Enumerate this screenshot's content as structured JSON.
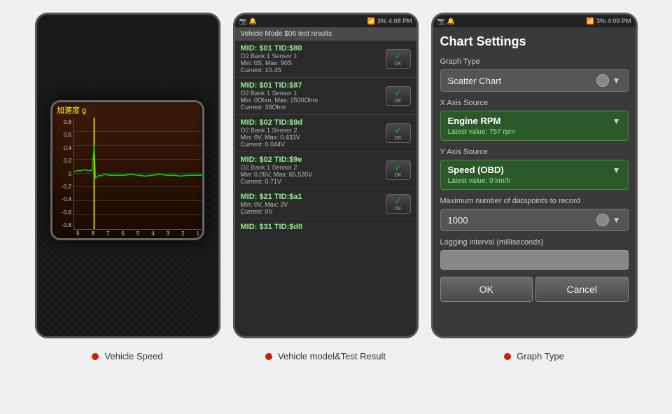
{
  "panel1": {
    "chart_title": "加速度 g",
    "y_labels": [
      "0.8",
      "0.6",
      "0.4",
      "0.2",
      "0",
      "-0.2",
      "-0.4",
      "-0.6",
      "-0.8"
    ],
    "x_labels": [
      "9",
      "8",
      "7",
      "6",
      "5",
      "4",
      "3",
      "2",
      "1"
    ],
    "label": "Vehicle Speed"
  },
  "panel2": {
    "status_bar_time": "4:08 PM",
    "status_bar_battery": "3%",
    "mode_header": "Vehicle Mode $06 test results",
    "items": [
      {
        "mid": "MID: $01 TID:$80",
        "sensor": "O2 Bank 1 Sensor 1",
        "range": "Min: 0S, Max: 90S",
        "current": "Current: 10.4S"
      },
      {
        "mid": "MID: $01 TID:$87",
        "sensor": "O2 Bank 1 Sensor 1",
        "range": "Min: 0Ohm, Max: 2500Ohm",
        "current": "Current: 38Ohm"
      },
      {
        "mid": "MID: $02 TID:$9d",
        "sensor": "O2 Bank 1 Sensor 2",
        "range": "Min: 0V, Max: 0.433V",
        "current": "Current: 0.044V"
      },
      {
        "mid": "MID: $02 TID:$9e",
        "sensor": "O2 Bank 1 Sensor 2",
        "range": "Min: 0.05V, Max: 65.535V",
        "current": "Current: 0.71V"
      },
      {
        "mid": "MID: $21 TID:$a1",
        "sensor": "",
        "range": "Min: 0V, Max: 3V",
        "current": "Current: 0V"
      },
      {
        "mid": "MID: $31 TID:$d0",
        "sensor": "",
        "range": "",
        "current": ""
      }
    ],
    "ok_label": "OK",
    "label": "Vehicle model&Test Result"
  },
  "panel3": {
    "status_bar_time": "4:09 PM",
    "status_bar_battery": "3%",
    "title": "Chart Settings",
    "graph_type_label": "Graph Type",
    "graph_type_value": "Scatter Chart",
    "x_axis_label": "X Axis Source",
    "x_axis_value": "Engine RPM",
    "x_axis_latest": "Latest value: 757 rpm",
    "y_axis_label": "Y Axis Source",
    "y_axis_value": "Speed (OBD)",
    "y_axis_latest": "Latest value: 0 km/h",
    "max_datapoints_label": "Maximum number of datapoints to record",
    "max_datapoints_value": "1000",
    "logging_label": "Logging interval (milliseconds)",
    "ok_btn": "OK",
    "cancel_btn": "Cancel",
    "label": "Graph Type"
  }
}
